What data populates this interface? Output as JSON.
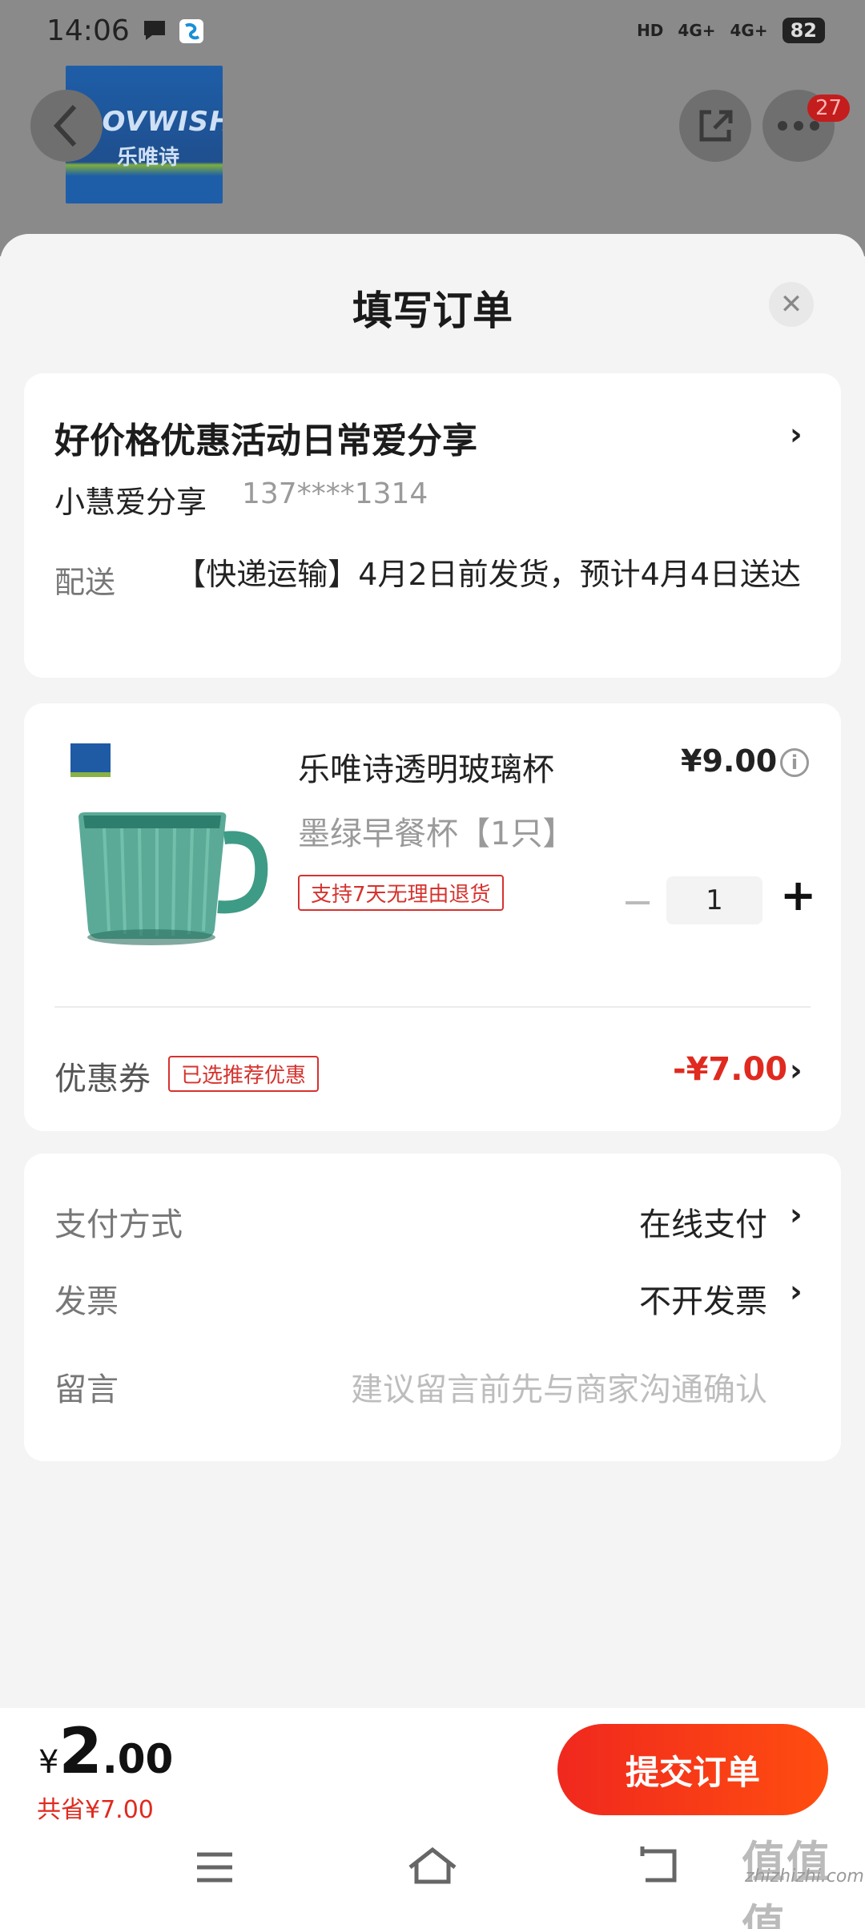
{
  "status_bar": {
    "time": "14:06",
    "battery": "82",
    "signal1": "4G+",
    "signal2": "4G+",
    "hd": "HD"
  },
  "background": {
    "logo_text_en": "LOVWISH",
    "logo_text_cn": "乐唯诗",
    "badge_count": "27"
  },
  "sheet": {
    "title": "填写订单",
    "close_symbol": "✕"
  },
  "address": {
    "title": "好价格优惠活动日常爱分享",
    "name": "小慧爱分享",
    "phone": "137****1314",
    "delivery_label": "配送",
    "delivery_text": "【快递运输】4月2日前发货，预计4月4日送达"
  },
  "product": {
    "name": "乐唯诗透明玻璃杯",
    "price": "¥9.00",
    "variant": "墨绿早餐杯【1只】",
    "return_tag": "支持7天无理由退货",
    "quantity": "1",
    "coupon_label": "优惠券",
    "coupon_tag": "已选推荐优惠",
    "coupon_value": "-¥7.00"
  },
  "options": {
    "payment_label": "支付方式",
    "payment_value": "在线支付",
    "invoice_label": "发票",
    "invoice_value": "不开发票",
    "message_label": "留言",
    "message_placeholder": "建议留言前先与商家沟通确认"
  },
  "footer": {
    "currency": "¥",
    "total_int": "2",
    "total_dec": ".00",
    "saved": "共省¥7.00",
    "submit_label": "提交订单"
  },
  "watermark": {
    "text": "zhizhizhi.com",
    "logo": "值值值"
  },
  "colors": {
    "accent_red": "#e02a1f",
    "button_gradient_start": "#f0281e",
    "button_gradient_end": "#ff4d10"
  }
}
